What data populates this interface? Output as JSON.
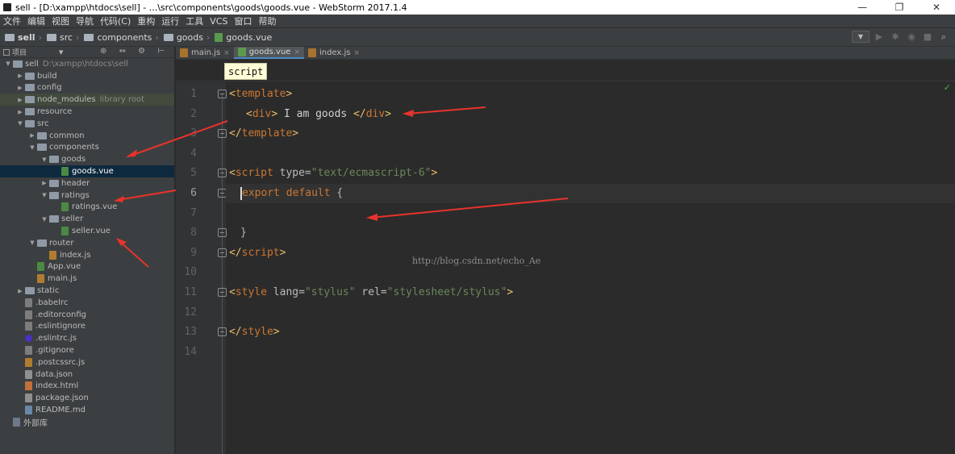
{
  "window": {
    "title": "sell - [D:\\xampp\\htdocs\\sell] - ...\\src\\components\\goods\\goods.vue - WebStorm 2017.1.4",
    "minimize": "—",
    "maximize": "❐",
    "close": "✕"
  },
  "menu": [
    "文件",
    "编辑",
    "视图",
    "导航",
    "代码(C)",
    "重构",
    "运行",
    "工具",
    "VCS",
    "窗口",
    "帮助"
  ],
  "breadcrumb": [
    "sell",
    "src",
    "components",
    "goods",
    "goods.vue"
  ],
  "toolbar": {
    "run_dropdown": "▼",
    "run": "▶",
    "debug": "✱",
    "coverage": "◉",
    "stop": "■",
    "search": "⌕"
  },
  "project": {
    "title": "项目",
    "tools": "⊕ ⇔ ⚙ ⊢",
    "tree": [
      {
        "name": "sell",
        "sub": "D:\\xampp\\htdocs\\sell",
        "type": "folder",
        "arrow": "▼"
      },
      {
        "name": "build",
        "type": "folder",
        "arrow": "▶"
      },
      {
        "name": "config",
        "type": "folder",
        "arrow": "▶"
      },
      {
        "name": "node_modules",
        "sub": "library root",
        "type": "folder",
        "arrow": "▶"
      },
      {
        "name": "resource",
        "type": "folder",
        "arrow": "▶"
      },
      {
        "name": "src",
        "type": "folder",
        "arrow": "▼"
      },
      {
        "name": "common",
        "type": "folder",
        "arrow": "▶"
      },
      {
        "name": "components",
        "type": "folder",
        "arrow": "▼"
      },
      {
        "name": "goods",
        "type": "folder",
        "arrow": "▼"
      },
      {
        "name": "goods.vue",
        "type": "vue"
      },
      {
        "name": "header",
        "type": "folder",
        "arrow": "▶"
      },
      {
        "name": "ratings",
        "type": "folder",
        "arrow": "▼"
      },
      {
        "name": "ratings.vue",
        "type": "vue"
      },
      {
        "name": "seller",
        "type": "folder",
        "arrow": "▼"
      },
      {
        "name": "seller.vue",
        "type": "vue"
      },
      {
        "name": "router",
        "type": "folder",
        "arrow": "▼"
      },
      {
        "name": "index.js",
        "type": "js"
      },
      {
        "name": "App.vue",
        "type": "vue"
      },
      {
        "name": "main.js",
        "type": "js"
      },
      {
        "name": "static",
        "type": "folder",
        "arrow": "▶"
      },
      {
        "name": ".babelrc",
        "type": "dot"
      },
      {
        "name": ".editorconfig",
        "type": "dot"
      },
      {
        "name": ".eslintignore",
        "type": "dot"
      },
      {
        "name": ".eslintrc.js",
        "type": "eslint"
      },
      {
        "name": ".gitignore",
        "type": "dot"
      },
      {
        "name": ".postcssrc.js",
        "type": "js"
      },
      {
        "name": "data.json",
        "type": "json"
      },
      {
        "name": "index.html",
        "type": "html"
      },
      {
        "name": "package.json",
        "type": "json"
      },
      {
        "name": "README.md",
        "type": "md"
      },
      {
        "name": "外部库",
        "type": "lib"
      }
    ]
  },
  "tabs": [
    {
      "label": "main.js",
      "close": "×"
    },
    {
      "label": "goods.vue",
      "close": "×"
    },
    {
      "label": "index.js",
      "close": "×"
    }
  ],
  "editor_breadcrumb": "script",
  "line_numbers": [
    "1",
    "2",
    "3",
    "4",
    "5",
    "6",
    "7",
    "8",
    "9",
    "10",
    "11",
    "12",
    "13",
    "14"
  ],
  "code": {
    "l1_open": "<",
    "l1_tag": "template",
    "l1_close": ">",
    "l2_a": "<",
    "l2_b": "div",
    "l2_c": ">",
    "l2_text": " I am goods ",
    "l2_d": "</",
    "l2_e": "div",
    "l2_f": ">",
    "l3_open": "</",
    "l3_tag": "template",
    "l3_close": ">",
    "l5_open": "<",
    "l5_tag": "script",
    "l5_attr": " type=",
    "l5_val": "\"text/ecmascript-6\"",
    "l5_close": ">",
    "l6_kw1": "export",
    "l6_kw2": " default",
    "l6_rest": " {",
    "l8_text": "}",
    "l9_open": "</",
    "l9_tag": "script",
    "l9_close": ">",
    "l11_open": "<",
    "l11_tag": "style",
    "l11_attr1": " lang=",
    "l11_val1": "\"stylus\"",
    "l11_attr2": " rel=",
    "l11_val2": "\"stylesheet/stylus\"",
    "l11_close": ">",
    "l13_open": "</",
    "l13_tag": "style",
    "l13_close": ">"
  },
  "watermark": "http://blog.csdn.net/echo_Ae",
  "status_check": "✓",
  "colors": {
    "annotation_arrow": "#e8332c",
    "selection": "#0d293e",
    "accent": "#4a88c7"
  }
}
